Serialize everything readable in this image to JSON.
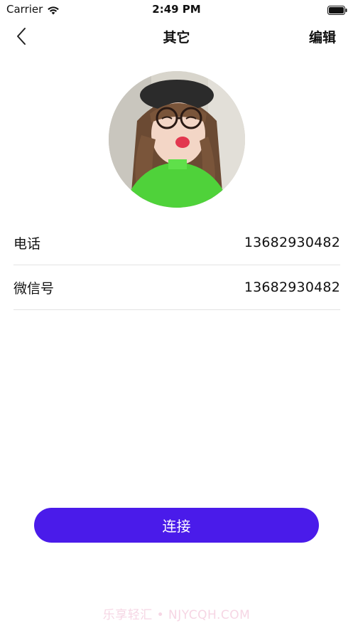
{
  "status_bar": {
    "carrier": "Carrier",
    "time": "2:49 PM",
    "wifi_icon": "wifi-icon",
    "battery_icon": "battery-icon"
  },
  "nav": {
    "back_icon": "chevron-left-icon",
    "title": "其它",
    "edit_label": "编辑"
  },
  "profile": {
    "avatar": "avatar-photo"
  },
  "info": [
    {
      "label": "电话",
      "value": "13682930482"
    },
    {
      "label": "微信号",
      "value": "13682930482"
    }
  ],
  "connect_label": "连接",
  "watermark": "乐享轻汇 • NJYCQH.COM",
  "colors": {
    "accent": "#4a1bea",
    "divider": "#e3e3e3",
    "watermark": "#f6d6e4"
  }
}
